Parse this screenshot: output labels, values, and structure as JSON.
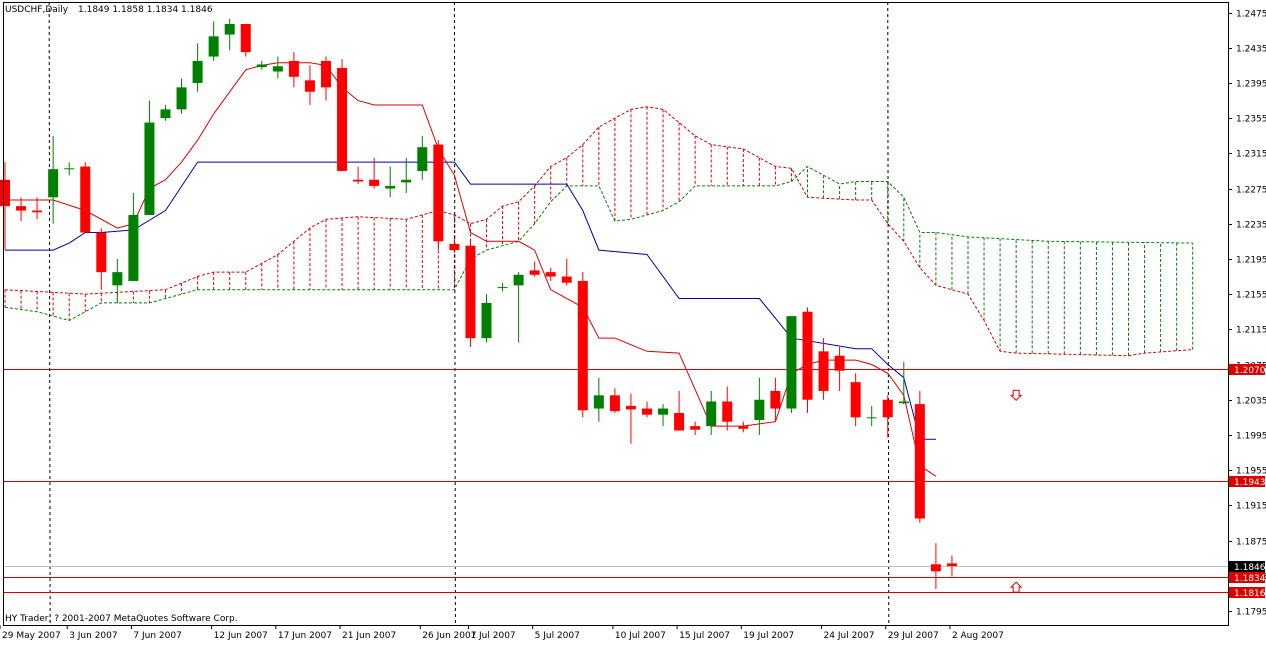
{
  "header": {
    "symbol": "USDCHF,Daily",
    "ohlc": "1.1849 1.1858 1.1834 1.1846"
  },
  "footer": {
    "copyright": "HY Trader, ? 2001-2007 MetaQuotes Software Corp."
  },
  "colors": {
    "bull": "#008000",
    "bear": "#ff0000",
    "tenkan": "#dd0000",
    "kijun": "#0000aa",
    "hline": "#dd0000",
    "cloud_bull": "#008000",
    "cloud_bear": "#dd0000"
  },
  "chart_data": {
    "type": "candlestick",
    "ylim": [
      1.1779,
      1.2487
    ],
    "y_ticks": [
      "1.2475",
      "1.2435",
      "1.2395",
      "1.2355",
      "1.2315",
      "1.2275",
      "1.2235",
      "1.2195",
      "1.2155",
      "1.2115",
      "1.2075",
      "1.2035",
      "1.1995",
      "1.1955",
      "1.1915",
      "1.1875",
      "1.1835",
      "1.1795"
    ],
    "x_labels": [
      {
        "bar": 0,
        "text": "29 May 2007"
      },
      {
        "bar": 4,
        "text": "3 Jun 2007"
      },
      {
        "bar": 8,
        "text": "7 Jun 2007"
      },
      {
        "bar": 13,
        "text": "12 Jun 2007"
      },
      {
        "bar": 17,
        "text": "17 Jun 2007"
      },
      {
        "bar": 21,
        "text": "21 Jun 2007"
      },
      {
        "bar": 26,
        "text": "26 Jun 2007"
      },
      {
        "bar": 29,
        "text": "1 Jul 2007"
      },
      {
        "bar": 33,
        "text": "5 Jul 2007"
      },
      {
        "bar": 38,
        "text": "10 Jul 2007"
      },
      {
        "bar": 42,
        "text": "15 Jul 2007"
      },
      {
        "bar": 46,
        "text": "19 Jul 2007"
      },
      {
        "bar": 51,
        "text": "24 Jul 2007"
      },
      {
        "bar": 55,
        "text": "29 Jul 2007"
      },
      {
        "bar": 59,
        "text": "2 Aug 2007"
      }
    ],
    "period_separators": [
      3,
      28,
      55
    ],
    "candles": [
      [
        1.2285,
        1.2305,
        1.2205,
        1.2255
      ],
      [
        1.2255,
        1.2265,
        1.2238,
        1.225
      ],
      [
        1.225,
        1.2265,
        1.224,
        1.2248
      ],
      [
        1.2265,
        1.2335,
        1.2235,
        1.2297
      ],
      [
        1.2297,
        1.2305,
        1.229,
        1.2298
      ],
      [
        1.23,
        1.2305,
        1.2225,
        1.2225
      ],
      [
        1.2225,
        1.223,
        1.216,
        1.218
      ],
      [
        1.2165,
        1.2195,
        1.2145,
        1.218
      ],
      [
        1.217,
        1.227,
        1.217,
        1.2245
      ],
      [
        1.2245,
        1.2375,
        1.2245,
        1.235
      ],
      [
        1.2355,
        1.237,
        1.2352,
        1.2365
      ],
      [
        1.2365,
        1.24,
        1.236,
        1.239
      ],
      [
        1.2395,
        1.244,
        1.2385,
        1.242
      ],
      [
        1.2425,
        1.2465,
        1.242,
        1.2448
      ],
      [
        1.245,
        1.2468,
        1.2432,
        1.2462
      ],
      [
        1.2462,
        1.2462,
        1.2425,
        1.243
      ],
      [
        1.2413,
        1.242,
        1.241,
        1.2416
      ],
      [
        1.2408,
        1.2425,
        1.24,
        1.2414
      ],
      [
        1.242,
        1.243,
        1.239,
        1.2402
      ],
      [
        1.2398,
        1.2415,
        1.237,
        1.2385
      ],
      [
        1.242,
        1.2425,
        1.2375,
        1.239
      ],
      [
        1.2412,
        1.2422,
        1.2295,
        1.2295
      ],
      [
        1.2285,
        1.23,
        1.228,
        1.2283
      ],
      [
        1.2285,
        1.231,
        1.2275,
        1.2278
      ],
      [
        1.2275,
        1.23,
        1.2265,
        1.2278
      ],
      [
        1.2282,
        1.231,
        1.227,
        1.2285
      ],
      [
        1.2295,
        1.2335,
        1.2285,
        1.2322
      ],
      [
        1.2325,
        1.233,
        1.2205,
        1.2215
      ],
      [
        1.2212,
        1.2218,
        1.2202,
        1.2205
      ],
      [
        1.221,
        1.2218,
        1.2095,
        1.2105
      ],
      [
        1.2105,
        1.2155,
        1.21,
        1.2145
      ],
      [
        1.2162,
        1.2168,
        1.2158,
        1.2163
      ],
      [
        1.2165,
        1.218,
        1.21,
        1.2177
      ],
      [
        1.2182,
        1.2192,
        1.2175,
        1.2177
      ],
      [
        1.218,
        1.2185,
        1.217,
        1.2175
      ],
      [
        1.2175,
        1.2195,
        1.2165,
        1.2168
      ],
      [
        1.217,
        1.218,
        1.2015,
        1.2023
      ],
      [
        1.2025,
        1.206,
        1.201,
        1.204
      ],
      [
        1.204,
        1.2048,
        1.202,
        1.2022
      ],
      [
        1.2028,
        1.2042,
        1.1985,
        1.2024
      ],
      [
        1.2025,
        1.2033,
        1.2015,
        1.2018
      ],
      [
        1.2018,
        1.203,
        1.2005,
        1.2025
      ],
      [
        1.202,
        1.2045,
        1.2,
        1.2
      ],
      [
        1.2005,
        1.201,
        1.1995,
        1.2001
      ],
      [
        1.2005,
        1.2045,
        1.1995,
        1.2033
      ],
      [
        1.2033,
        1.205,
        1.2,
        1.201
      ],
      [
        1.2005,
        1.201,
        1.1998,
        1.2002
      ],
      [
        1.2012,
        1.206,
        1.1995,
        1.2035
      ],
      [
        1.2045,
        1.206,
        1.201,
        1.2025
      ],
      [
        1.2025,
        1.213,
        1.202,
        1.213
      ],
      [
        1.2135,
        1.214,
        1.202,
        1.2035
      ],
      [
        1.209,
        1.2105,
        1.2035,
        1.2045
      ],
      [
        1.2085,
        1.2095,
        1.2045,
        1.2068
      ],
      [
        1.2055,
        1.2065,
        1.2005,
        1.2015
      ],
      [
        1.2015,
        1.2028,
        1.2005,
        1.2015
      ],
      [
        1.2035,
        1.204,
        1.1992,
        1.2015
      ],
      [
        1.2031,
        1.2078,
        1.203,
        1.2033
      ],
      [
        1.203,
        1.2045,
        1.1895,
        1.19
      ],
      [
        1.1848,
        1.1872,
        1.182,
        1.184
      ],
      [
        1.1849,
        1.1858,
        1.1834,
        1.1846
      ]
    ],
    "tenkan": [
      [
        0,
        1.2262
      ],
      [
        3,
        1.2262
      ],
      [
        5,
        1.225
      ],
      [
        7,
        1.223
      ],
      [
        8,
        1.2235
      ],
      [
        9,
        1.2275
      ],
      [
        10,
        1.2285
      ],
      [
        11,
        1.2305
      ],
      [
        12,
        1.233
      ],
      [
        13,
        1.236
      ],
      [
        14,
        1.2385
      ],
      [
        15,
        1.241
      ],
      [
        16,
        1.2415
      ],
      [
        17,
        1.2418
      ],
      [
        18,
        1.2418
      ],
      [
        19,
        1.2418
      ],
      [
        20,
        1.2415
      ],
      [
        21,
        1.239
      ],
      [
        22,
        1.2375
      ],
      [
        23,
        1.237
      ],
      [
        25,
        1.237
      ],
      [
        26,
        1.237
      ],
      [
        27,
        1.232
      ],
      [
        28,
        1.229
      ],
      [
        29,
        1.2225
      ],
      [
        30,
        1.2215
      ],
      [
        32,
        1.2215
      ],
      [
        33,
        1.2205
      ],
      [
        34,
        1.216
      ],
      [
        36,
        1.214
      ],
      [
        37,
        1.2105
      ],
      [
        38,
        1.2105
      ],
      [
        40,
        1.209
      ],
      [
        42,
        1.2088
      ],
      [
        44,
        1.2005
      ],
      [
        46,
        1.2005
      ],
      [
        48,
        1.201
      ],
      [
        49,
        1.2065
      ],
      [
        50,
        1.2075
      ],
      [
        51,
        1.208
      ],
      [
        53,
        1.208
      ],
      [
        54,
        1.2075
      ],
      [
        55,
        1.2065
      ],
      [
        56,
        1.204
      ],
      [
        57,
        1.196
      ],
      [
        58,
        1.1948
      ]
    ],
    "kijun": [
      [
        0,
        1.2205
      ],
      [
        3,
        1.2205
      ],
      [
        4,
        1.2213
      ],
      [
        5,
        1.2225
      ],
      [
        6,
        1.2225
      ],
      [
        8,
        1.2228
      ],
      [
        10,
        1.225
      ],
      [
        12,
        1.2305
      ],
      [
        28,
        1.2305
      ],
      [
        29,
        1.228
      ],
      [
        35,
        1.228
      ],
      [
        36,
        1.225
      ],
      [
        37,
        1.2205
      ],
      [
        40,
        1.22
      ],
      [
        42,
        1.215
      ],
      [
        47,
        1.215
      ],
      [
        49,
        1.2105
      ],
      [
        53,
        1.2093
      ],
      [
        54,
        1.2093
      ],
      [
        55,
        1.2075
      ],
      [
        56,
        1.206
      ],
      [
        57,
        1.199
      ],
      [
        58,
        1.199
      ]
    ],
    "cloud_a": [
      [
        0,
        1.216
      ],
      [
        5,
        1.2155
      ],
      [
        10,
        1.216
      ],
      [
        12,
        1.2175
      ],
      [
        13,
        1.218
      ],
      [
        15,
        1.218
      ],
      [
        16,
        1.219
      ],
      [
        17,
        1.22
      ],
      [
        18,
        1.2215
      ],
      [
        19,
        1.223
      ],
      [
        20,
        1.224
      ],
      [
        22,
        1.2243
      ],
      [
        25,
        1.224
      ],
      [
        26,
        1.2245
      ],
      [
        27,
        1.225
      ],
      [
        28,
        1.2245
      ],
      [
        29,
        1.2235
      ],
      [
        30,
        1.224
      ],
      [
        31,
        1.2255
      ],
      [
        32,
        1.226
      ],
      [
        33,
        1.2278
      ],
      [
        34,
        1.23
      ],
      [
        35,
        1.231
      ],
      [
        36,
        1.2325
      ],
      [
        37,
        1.2345
      ],
      [
        38,
        1.2355
      ],
      [
        39,
        1.2365
      ],
      [
        40,
        1.2368
      ],
      [
        41,
        1.2365
      ],
      [
        42,
        1.235
      ],
      [
        43,
        1.2335
      ],
      [
        44,
        1.2325
      ],
      [
        46,
        1.232
      ],
      [
        47,
        1.231
      ],
      [
        48,
        1.23
      ],
      [
        49,
        1.2298
      ],
      [
        50,
        1.2265
      ],
      [
        52,
        1.2263
      ],
      [
        53,
        1.2262
      ],
      [
        54,
        1.2262
      ],
      [
        55,
        1.2235
      ],
      [
        56,
        1.2215
      ],
      [
        57,
        1.2185
      ],
      [
        58,
        1.2165
      ],
      [
        60,
        1.2155
      ],
      [
        61,
        1.2125
      ],
      [
        62,
        1.209
      ],
      [
        63,
        1.2088
      ],
      [
        70,
        1.2085
      ],
      [
        71,
        1.2088
      ],
      [
        74,
        1.2092
      ]
    ],
    "cloud_b": [
      [
        0,
        1.214
      ],
      [
        2,
        1.2135
      ],
      [
        3,
        1.213
      ],
      [
        4,
        1.2125
      ],
      [
        5,
        1.2135
      ],
      [
        6,
        1.2145
      ],
      [
        9,
        1.2145
      ],
      [
        12,
        1.216
      ],
      [
        28,
        1.216
      ],
      [
        29,
        1.2195
      ],
      [
        30,
        1.2205
      ],
      [
        32,
        1.2215
      ],
      [
        33,
        1.2235
      ],
      [
        34,
        1.226
      ],
      [
        35,
        1.2278
      ],
      [
        37,
        1.2278
      ],
      [
        38,
        1.2238
      ],
      [
        39,
        1.224
      ],
      [
        40,
        1.2245
      ],
      [
        41,
        1.225
      ],
      [
        42,
        1.226
      ],
      [
        43,
        1.2278
      ],
      [
        48,
        1.2278
      ],
      [
        49,
        1.2283
      ],
      [
        50,
        1.23
      ],
      [
        51,
        1.229
      ],
      [
        52,
        1.228
      ],
      [
        53,
        1.2283
      ],
      [
        54,
        1.2283
      ],
      [
        55,
        1.2283
      ],
      [
        56,
        1.2265
      ],
      [
        57,
        1.2225
      ],
      [
        58,
        1.2225
      ],
      [
        60,
        1.222
      ],
      [
        65,
        1.2215
      ],
      [
        74,
        1.2213
      ]
    ],
    "h_levels": [
      {
        "value": 1.207,
        "label": "1.2070",
        "style": "red"
      },
      {
        "value": 1.1943,
        "label": "1.1943",
        "style": "red"
      },
      {
        "value": 1.1834,
        "label": "1.1834",
        "style": "red"
      },
      {
        "value": 1.1816,
        "label": "1.1816",
        "style": "red"
      },
      {
        "value": 1.1846,
        "label": "1.1846",
        "style": "bid"
      }
    ],
    "arrows": [
      {
        "bar": 63,
        "value": 1.204,
        "dir": "down"
      },
      {
        "bar": 63,
        "value": 1.1822,
        "dir": "up"
      }
    ]
  }
}
